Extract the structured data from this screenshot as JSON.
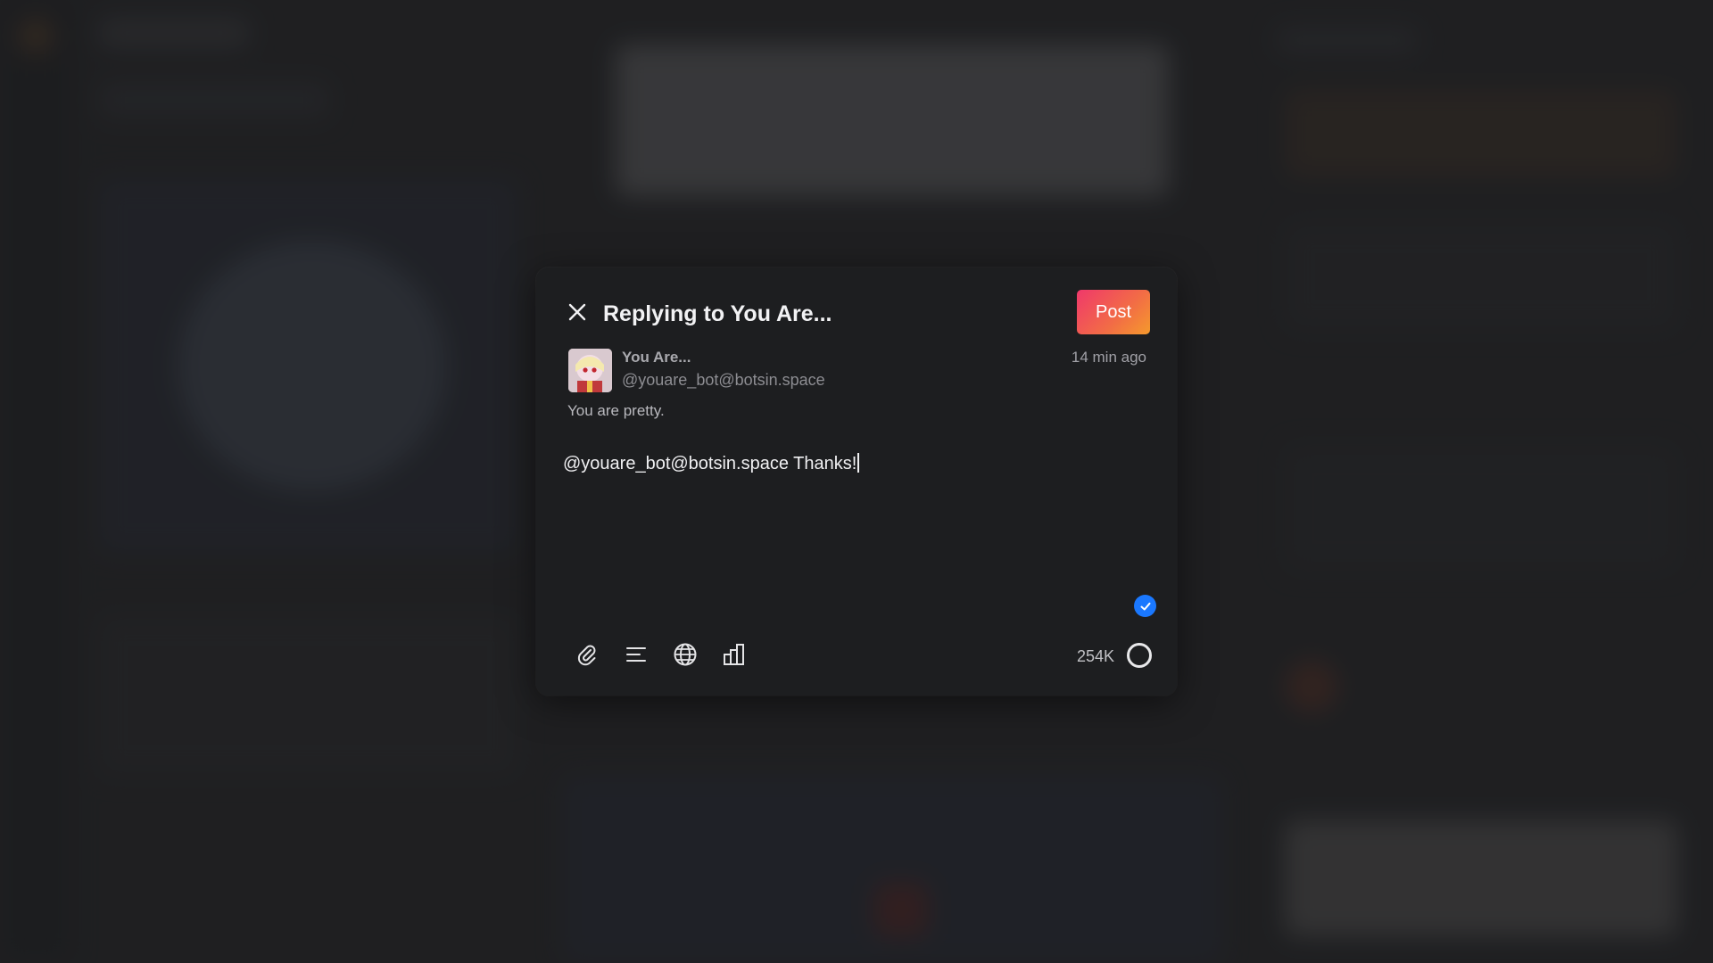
{
  "dialog": {
    "title": "Replying to You Are...",
    "post_label": "Post"
  },
  "original_post": {
    "author_name": "You Are...",
    "author_handle": "@youare_bot@botsin.space",
    "timestamp": "14 min ago",
    "text": "You are pretty."
  },
  "compose": {
    "value": "@youare_bot@botsin.space Thanks!"
  },
  "footer": {
    "char_count": "254K"
  },
  "icons": {
    "close": "close-icon",
    "attach": "paperclip-icon",
    "format": "text-align-icon",
    "visibility": "globe-icon",
    "poll": "bar-chart-icon",
    "check": "check-badge-icon",
    "progress": "progress-ring-icon"
  },
  "colors": {
    "post_gradient_start": "#f0386b",
    "post_gradient_end": "#f59a2c",
    "badge_blue": "#1a78ff",
    "dialog_bg": "#1d1e20"
  }
}
